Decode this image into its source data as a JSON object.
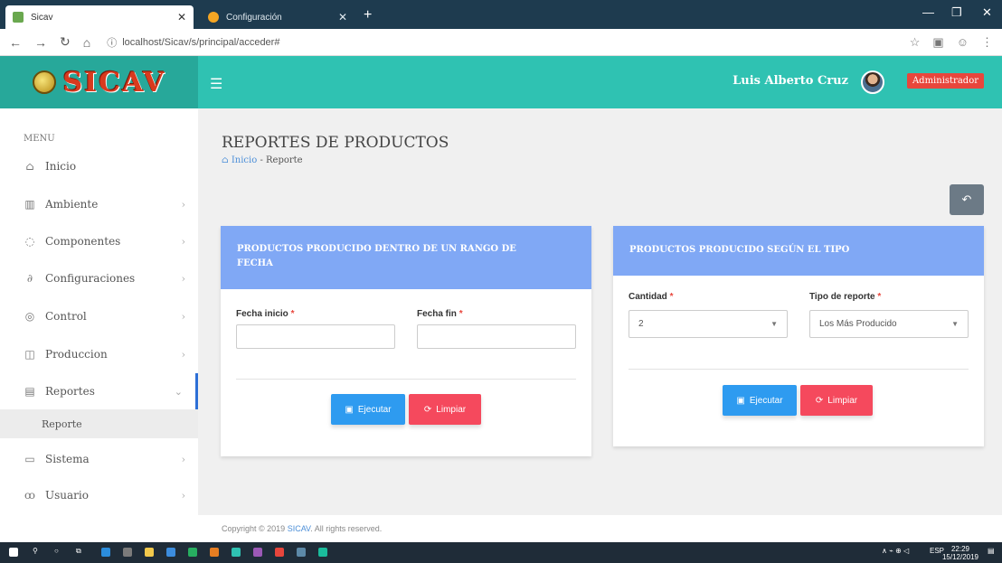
{
  "browser": {
    "active_tab": "Sicav",
    "inactive_tab": "Configuración",
    "new_tab_label": "+",
    "url": "localhost/Sicav/s/principal/acceder#"
  },
  "header": {
    "logo": "SICAV",
    "user_name": "Luis Alberto Cruz",
    "role": "Administrador"
  },
  "sidebar": {
    "menu_title": "MENU",
    "items": [
      {
        "label": "Inicio",
        "icon": "home-icon"
      },
      {
        "label": "Ambiente",
        "icon": "bank-icon"
      },
      {
        "label": "Componentes",
        "icon": "component-icon"
      },
      {
        "label": "Configuraciones",
        "icon": "link-icon"
      },
      {
        "label": "Control",
        "icon": "control-icon"
      },
      {
        "label": "Produccion",
        "icon": "box-icon"
      },
      {
        "label": "Reportes",
        "icon": "chart-icon"
      },
      {
        "label": "Sistema",
        "icon": "window-icon"
      },
      {
        "label": "Usuario",
        "icon": "users-icon"
      }
    ],
    "sub_item": "Reporte"
  },
  "page": {
    "title": "REPORTES DE PRODUCTOS",
    "breadcrumb_home": "Inicio",
    "breadcrumb_sep": "-",
    "breadcrumb_current": "Reporte"
  },
  "card_date": {
    "title": "PRODUCTOS PRODUCIDO DENTRO DE UN RANGO DE FECHA",
    "start_label": "Fecha inicio",
    "end_label": "Fecha fin",
    "required_mark": "*",
    "start_value": "",
    "end_value": "",
    "run_label": "Ejecutar",
    "clear_label": "Limpiar"
  },
  "card_type": {
    "title": "PRODUCTOS PRODUCIDO SEGÚN EL TIPO",
    "quantity_label": "Cantidad",
    "type_label": "Tipo de reporte",
    "required_mark": "*",
    "quantity_value": "2",
    "type_value": "Los Más Producido",
    "run_label": "Ejecutar",
    "clear_label": "Limpiar"
  },
  "footer": {
    "prefix": "Copyright © 2019 ",
    "link": "SICAV",
    "suffix": ". All rights reserved."
  },
  "taskbar": {
    "lang": "ESP",
    "time": "22:29",
    "date": "15/12/2019"
  },
  "colors": {
    "header_teal": "#2fc2b2",
    "card_header_blue": "#80a8f5",
    "button_blue": "#2e9bf0",
    "button_red": "#f5495d",
    "badge_red": "#e8463c"
  }
}
